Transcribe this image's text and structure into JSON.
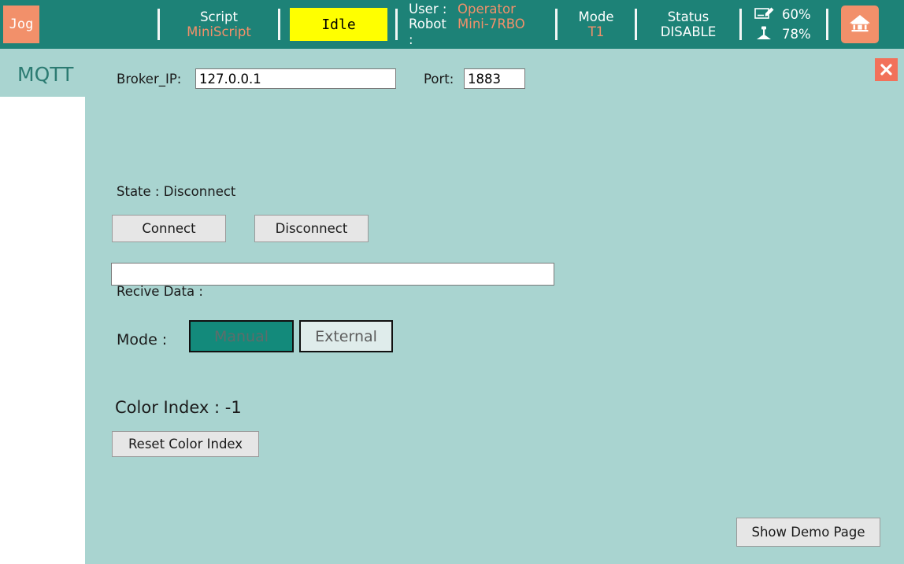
{
  "statusbar": {
    "jog_label": "Jog",
    "script": {
      "title": "Script",
      "value": "MiniScript"
    },
    "state_badge": "Idle",
    "user": {
      "label": "User :",
      "value": "Operator"
    },
    "robot": {
      "label": "Robot :",
      "value": "Mini-7RBO"
    },
    "mode": {
      "title": "Mode",
      "value": "T1"
    },
    "status": {
      "title": "Status",
      "value": "DISABLE"
    },
    "meters": [
      {
        "icon": "speed-override-icon",
        "value": "60%"
      },
      {
        "icon": "robot-arm-icon",
        "value": "78%"
      }
    ],
    "home_icon": "home-icon"
  },
  "page": {
    "tab_label": "MQTT",
    "close_icon": "close-icon",
    "broker": {
      "label": "Broker_IP:",
      "value": "127.0.0.1",
      "placeholder": ""
    },
    "port": {
      "label": "Port:",
      "value": "1883",
      "placeholder": ""
    },
    "state_line": "State : Disconnect",
    "connect_label": "Connect",
    "disconnect_label": "Disconnect",
    "receive": {
      "label": "Recive Data :",
      "value": "",
      "placeholder": ""
    },
    "mode": {
      "label": "Mode :",
      "options": [
        "Manual",
        "External"
      ],
      "selected": "Manual"
    },
    "color_index_line": "Color Index : -1",
    "reset_color_index_label": "Reset Color Index",
    "show_demo_label": "Show Demo Page"
  },
  "colors": {
    "header_bg": "#1d8277",
    "body_bg": "#a9d4d0",
    "accent_orange": "#f2906a",
    "idle_yellow": "#ffff00",
    "tab_text": "#2c7b72",
    "mode_selected": "#138a7b"
  }
}
